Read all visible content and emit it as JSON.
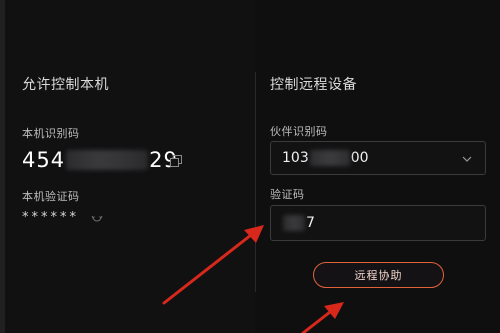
{
  "left": {
    "title": "允许控制本机",
    "device_id_label": "本机识别码",
    "device_id_prefix": "454",
    "device_id_suffix": "29",
    "password_label": "本机验证码",
    "password_value": "******"
  },
  "right": {
    "title": "控制远程设备",
    "partner_id_label": "伙伴识别码",
    "partner_id_prefix": "103",
    "partner_id_suffix": "00",
    "code_label": "验证码",
    "code_suffix": "7",
    "assist_button_label": "远程协助"
  },
  "colors": {
    "accent": "#e0623a",
    "arrow": "#d8281c",
    "background": "#0f0f10"
  },
  "icons": [
    "copy-icon",
    "refresh-icon",
    "chevron-down-icon"
  ]
}
